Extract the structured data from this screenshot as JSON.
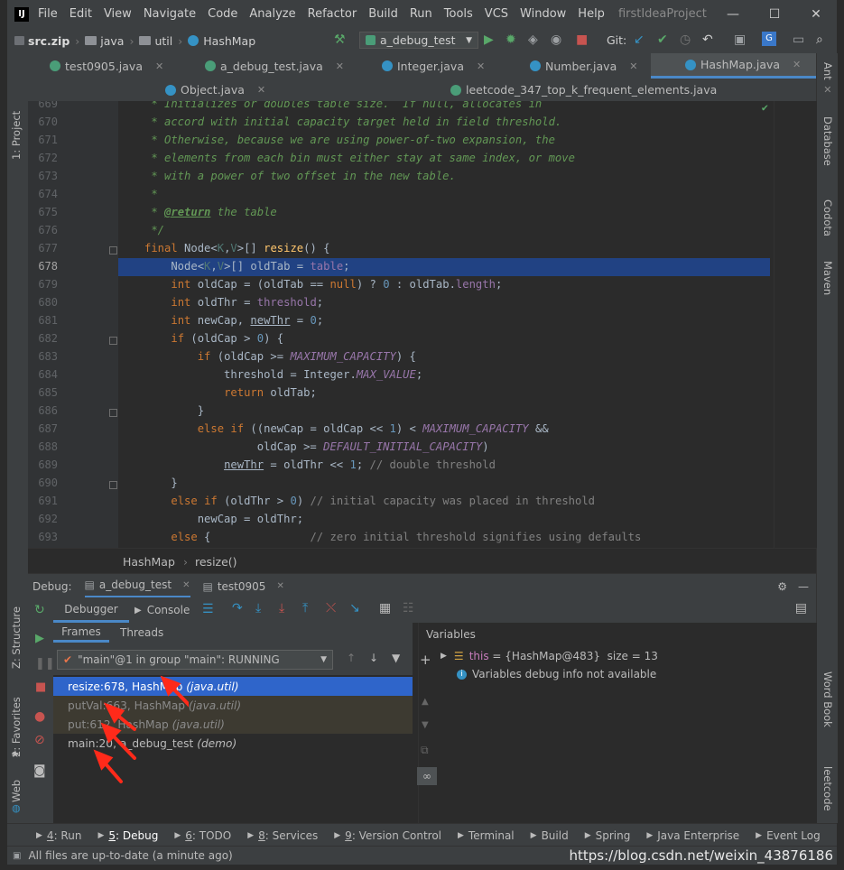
{
  "app_title": "firstIdeaProject",
  "menu": [
    "File",
    "Edit",
    "View",
    "Navigate",
    "Code",
    "Analyze",
    "Refactor",
    "Build",
    "Run",
    "Tools",
    "VCS",
    "Window",
    "Help"
  ],
  "window_controls": {
    "minimize": "—",
    "maximize": "☐",
    "close": "✕"
  },
  "breadcrumb": {
    "jar": "src.zip",
    "folder1": "java",
    "folder2": "util",
    "class": "HashMap"
  },
  "run_config": "a_debug_test",
  "git_label": "Git:",
  "editor_tabs_row1": [
    {
      "label": "test0905.java",
      "active": false
    },
    {
      "label": "a_debug_test.java",
      "active": false
    },
    {
      "label": "Integer.java",
      "active": false
    },
    {
      "label": "Number.java",
      "active": false
    },
    {
      "label": "HashMap.java",
      "active": true
    }
  ],
  "editor_tabs_row2": [
    {
      "label": "Object.java"
    },
    {
      "label": "leetcode_347_top_k_frequent_elements.java"
    }
  ],
  "left_tools": {
    "project": "1: Project",
    "structure": "Z: Structure",
    "favorites": "2: Favorites",
    "web": "Web"
  },
  "right_tools": {
    "ant": "Ant",
    "database": "Database",
    "codota": "Codota",
    "maven": "Maven",
    "wordbook": "Word Book",
    "leetcode": "leetcode"
  },
  "line_numbers": [
    "669",
    "670",
    "671",
    "672",
    "673",
    "674",
    "675",
    "676",
    "677",
    "678",
    "679",
    "680",
    "681",
    "682",
    "683",
    "684",
    "685",
    "686",
    "687",
    "688",
    "689",
    "690",
    "691",
    "692",
    "693"
  ],
  "current_line": "678",
  "code_lines": [
    " * Initializes or doubles table size.  If null, allocates in",
    " * accord with initial capacity target held in field threshold.",
    " * Otherwise, because we are using power-of-two expansion, the",
    " * elements from each bin must either stay at same index, or move",
    " * with a power of two offset in the new table.",
    " *",
    " * @return the table",
    " */",
    "final Node<K,V>[] resize() {",
    "    Node<K,V>[] oldTab = table;",
    "    int oldCap = (oldTab == null) ? 0 : oldTab.length;",
    "    int oldThr = threshold;",
    "    int newCap, newThr = 0;",
    "    if (oldCap > 0) {",
    "        if (oldCap >= MAXIMUM_CAPACITY) {",
    "            threshold = Integer.MAX_VALUE;",
    "            return oldTab;",
    "        }",
    "        else if ((newCap = oldCap << 1) < MAXIMUM_CAPACITY &&",
    "                 oldCap >= DEFAULT_INITIAL_CAPACITY)",
    "            newThr = oldThr << 1; // double threshold",
    "    }",
    "    else if (oldThr > 0) // initial capacity was placed in threshold",
    "        newCap = oldThr;",
    "    else {               // zero initial threshold signifies using defaults"
  ],
  "editor_breadcrumb": {
    "class": "HashMap",
    "method": "resize()"
  },
  "debug": {
    "label": "Debug:",
    "sessions": [
      "a_debug_test",
      "test0905"
    ],
    "tabs": {
      "debugger": "Debugger",
      "console": "Console"
    },
    "subtabs": {
      "frames": "Frames",
      "threads": "Threads"
    },
    "thread_select": "\"main\"@1 in group \"main\": RUNNING",
    "frames": [
      {
        "method": "resize:678, HashMap",
        "pkg": "(java.util)",
        "selected": true,
        "dim": false
      },
      {
        "method": "putVal:663, HashMap",
        "pkg": "(java.util)",
        "selected": false,
        "dim": true
      },
      {
        "method": "put:612, HashMap",
        "pkg": "(java.util)",
        "selected": false,
        "dim": true
      },
      {
        "method": "main:20, a_debug_test",
        "pkg": "(demo)",
        "selected": false,
        "dim": false
      }
    ],
    "variables_title": "Variables",
    "variables": [
      {
        "name": "this",
        "value": "= {HashMap@483}",
        "extra": "size = 13"
      }
    ],
    "variables_info": "Variables debug info not available"
  },
  "bottom_tools": [
    {
      "num": "4",
      "label": ": Run",
      "active": false
    },
    {
      "num": "5",
      "label": ": Debug",
      "active": true
    },
    {
      "num": "6",
      "label": ": TODO",
      "active": false
    },
    {
      "num": "8",
      "label": ": Services",
      "active": false
    },
    {
      "num": "9",
      "label": ": Version Control",
      "active": false
    },
    {
      "num": "",
      "label": "Terminal",
      "active": false
    },
    {
      "num": "",
      "label": "Build",
      "active": false
    },
    {
      "num": "",
      "label": "Spring",
      "active": false
    },
    {
      "num": "",
      "label": "Java Enterprise",
      "active": false
    },
    {
      "num": "",
      "label": "Event Log",
      "active": false
    }
  ],
  "status_text": "All files are up-to-date (a minute ago)",
  "watermark": "https://blog.csdn.net/weixin_43876186",
  "colors": {
    "accent": "#2f65ca",
    "current_line": "#214283",
    "arrow": "#ff2a1a",
    "bg": "#2b2b2b",
    "panel": "#3c3f41"
  }
}
